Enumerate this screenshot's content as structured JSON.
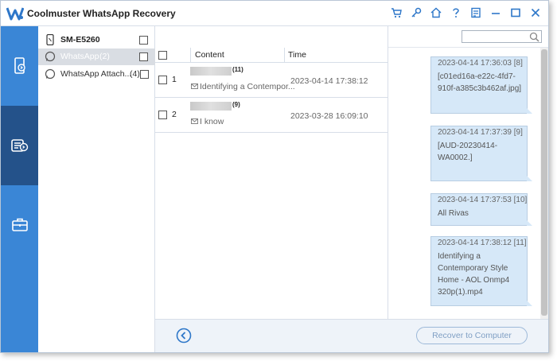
{
  "app": {
    "title": "Coolmuster WhatsApp Recovery"
  },
  "toolbar_icons": [
    "cart-icon",
    "key-icon",
    "home-icon",
    "help-icon",
    "feedback-icon",
    "minimize-icon",
    "maximize-icon",
    "close-icon"
  ],
  "colors": {
    "accent": "#3a86d6",
    "nav_active": "#24528a",
    "bubble": "#d6e8f8"
  },
  "tree": {
    "device": "SM-E5260",
    "items": [
      {
        "label": "WhatsApp",
        "count": "(2)"
      },
      {
        "label": "WhatsApp Attach...",
        "count": "(4)"
      }
    ]
  },
  "list": {
    "headers": {
      "content": "Content",
      "time": "Time"
    },
    "rows": [
      {
        "num": "1",
        "count": "(11)",
        "snippet": "Identifying a Contempor...",
        "time": "2023-04-14 17:38:12"
      },
      {
        "num": "2",
        "count": "(9)",
        "snippet": "I know",
        "time": "2023-03-28 16:09:10"
      }
    ]
  },
  "messages": [
    {
      "time": "2023-04-14 17:36:03",
      "idx": "[8]",
      "lines": [
        "[c01ed16a-e22c-4fd7-",
        "910f-a385c3b462af.jpg]"
      ]
    },
    {
      "time": "2023-04-14 17:37:39",
      "idx": "[9]",
      "lines": [
        "[AUD-20230414-",
        "WA0002.]"
      ]
    },
    {
      "time": "2023-04-14 17:37:53",
      "idx": "[10]",
      "lines": [
        "All Rivas"
      ]
    },
    {
      "time": "2023-04-14 17:38:12",
      "idx": "[11]",
      "lines": [
        "Identifying a",
        "Contemporary Style",
        "Home - AOL Onmp4",
        "320p(1).mp4"
      ]
    }
  ],
  "footer": {
    "recover_label": "Recover to Computer"
  }
}
